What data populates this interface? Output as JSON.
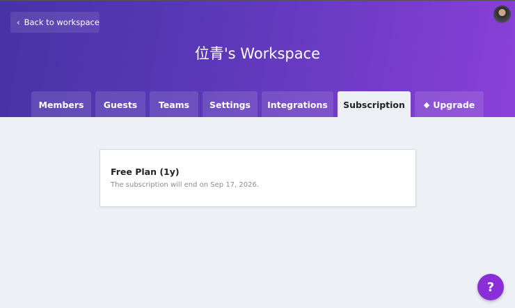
{
  "header": {
    "back_label": "Back to workspace",
    "title": "位青's Workspace"
  },
  "tabs": [
    {
      "label": "Members"
    },
    {
      "label": "Guests"
    },
    {
      "label": "Teams"
    },
    {
      "label": "Settings"
    },
    {
      "label": "Integrations"
    },
    {
      "label": "Subscription",
      "active": true
    },
    {
      "label": "Upgrade",
      "icon": "diamond-icon"
    }
  ],
  "subscription": {
    "plan": "Free Plan (1y)",
    "description": "The subscription will end on Sep 17, 2026."
  },
  "help": {
    "label": "?"
  }
}
